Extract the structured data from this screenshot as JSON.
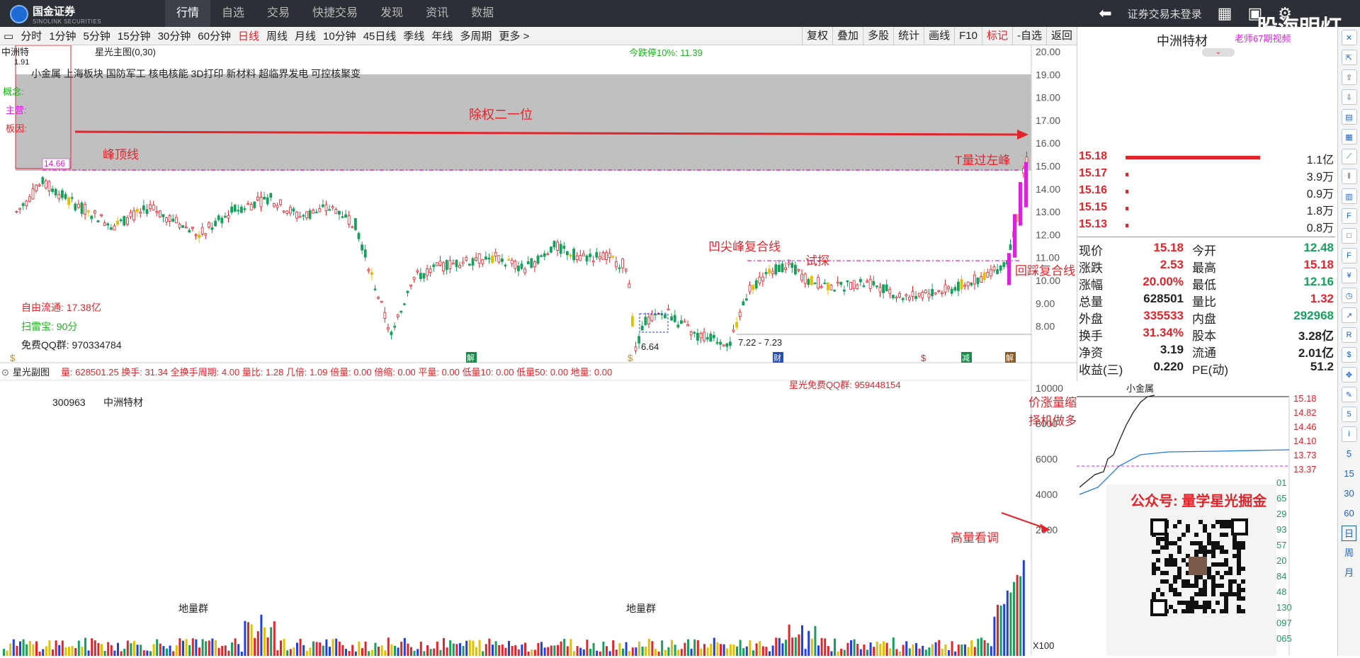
{
  "app": {
    "brand_cn": "国金证券",
    "brand_en": "SINOLINK SECURITIES",
    "nav_tabs": [
      "行情",
      "自选",
      "交易",
      "快捷交易",
      "发现",
      "资讯",
      "数据"
    ],
    "login_status": "证券交易未登录",
    "watermark": "股海明灯"
  },
  "toolbar": {
    "periods": [
      "分时",
      "1分钟",
      "5分钟",
      "15分钟",
      "30分钟",
      "60分钟",
      "日线",
      "周线",
      "月线",
      "10分钟",
      "45日线",
      "季线",
      "年线",
      "多周期",
      "更多 >"
    ],
    "active_period": "日线",
    "right_buttons": [
      "复权",
      "叠加",
      "多股",
      "统计",
      "画线",
      "F10",
      "标记",
      "-自选",
      "返回"
    ]
  },
  "chart_header": {
    "stock_short": "中洲特",
    "indicator": "星光主图(0,30)",
    "limit_down": "今跌停10%: 11.39",
    "concepts_line": "小金属  上海板块  国防军工 核电核能 3D打印 新材料 超临界发电 可控核聚变",
    "labels": {
      "concept": "概念:",
      "main": "主营:",
      "reason": "板因:"
    },
    "ex_right_note": "除权二一位",
    "small_price": "1.91"
  },
  "annotations": {
    "peak_line": "峰顶线",
    "peak_value": "14.66",
    "t_over_left": "T量过左峰",
    "concave_line": "凹尖峰复合线",
    "probe": "试探",
    "pullback": "回踩复合线",
    "low_value": "6.64",
    "date_range": "7.22 - 7.23",
    "free_float": "自由流通: 17.38亿",
    "scan_score": "扫雷宝: 90分",
    "qq_group": "免费QQ群: 970334784",
    "sub_qq_group": "星光免费QQ群: 959448154",
    "stock_code": "300963",
    "stock_name": "中洲特材",
    "price_up_vol_down": "价涨量缩",
    "pick_long": "择机做多",
    "high_vol": "高量看调",
    "volume_cluster_1": "地量群",
    "volume_cluster_2": "地量群",
    "subchart_title": "星光副图",
    "subchart_values": "量: 628501.25  换手: 31.34  全换手周期: 4.00  量比: 1.28  几倍: 1.09  倍量: 0.00  倍缩: 0.00  平量: 0.00  低量10: 0.00  低量50: 0.00  地量: 0.00",
    "x100": "X100",
    "event_markers": [
      "解",
      "财",
      "$",
      "减",
      "解"
    ]
  },
  "price_axis": [
    "20.00",
    "19.00",
    "18.00",
    "17.00",
    "16.00",
    "15.00",
    "14.00",
    "13.00",
    "12.00",
    "11.00",
    "10.00",
    "9.00",
    "8.00"
  ],
  "vol_axis": [
    "10000",
    "8000",
    "6000",
    "4000",
    "2000"
  ],
  "side": {
    "stock_name": "中洲特材",
    "promo": "老师67期视频",
    "order_book": [
      {
        "price": "15.18",
        "vol": "1.1亿"
      },
      {
        "price": "15.17",
        "vol": "3.9万"
      },
      {
        "price": "15.16",
        "vol": "0.9万"
      },
      {
        "price": "15.15",
        "vol": "1.8万"
      },
      {
        "price": "15.13",
        "vol": "0.8万"
      }
    ],
    "quote": [
      {
        "l1": "现价",
        "v1": "15.18",
        "l2": "今开",
        "v2": "12.48"
      },
      {
        "l1": "涨跌",
        "v1": "2.53",
        "l2": "最高",
        "v2": "15.18"
      },
      {
        "l1": "涨幅",
        "v1": "20.00%",
        "l2": "最低",
        "v2": "12.16"
      },
      {
        "l1": "总量",
        "v1": "628501",
        "l2": "量比",
        "v2": "1.32"
      },
      {
        "l1": "外盘",
        "v1": "335533",
        "l2": "内盘",
        "v2": "292968"
      },
      {
        "l1": "换手",
        "v1": "31.34%",
        "l2": "股本",
        "v2": "3.28亿"
      },
      {
        "l1": "净资",
        "v1": "3.19",
        "l2": "流通",
        "v2": "2.01亿"
      },
      {
        "l1": "收益(三)",
        "v1": "0.220",
        "l2": "PE(动)",
        "v2": "51.2"
      }
    ],
    "mini_chart_label": "小金属",
    "mini_prices": [
      "15.18",
      "14.82",
      "14.46",
      "14.10",
      "13.73",
      "13.37"
    ],
    "mini_right_nums": [
      "01",
      "65",
      "29",
      "93",
      "57",
      "20",
      "84",
      "48",
      "130",
      "097",
      "065"
    ],
    "promo_title": "公众号: 量学星光掘金"
  },
  "iconbar_numbers": [
    "5",
    "15",
    "30",
    "60"
  ],
  "iconbar_periods": [
    "日",
    "周",
    "月"
  ],
  "colors": {
    "up": "#e3242b",
    "down": "#17a05d",
    "magenta": "#e020e0",
    "panel_gray": "#c0c0c0"
  }
}
